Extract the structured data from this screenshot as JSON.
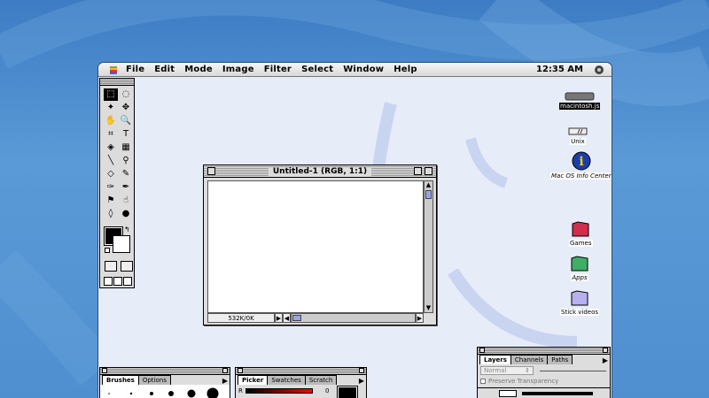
{
  "menubar": {
    "apple_icon": "apple-icon",
    "items": [
      "File",
      "Edit",
      "Mode",
      "Image",
      "Filter",
      "Select",
      "Window",
      "Help"
    ],
    "clock": "12:35 AM",
    "app_icon": "photoshop-app-icon"
  },
  "toolbox": {
    "tools": [
      {
        "name": "marquee-tool",
        "glyph": "⬚",
        "selected": true
      },
      {
        "name": "lasso-tool",
        "glyph": "◌",
        "selected": false
      },
      {
        "name": "magic-wand-tool",
        "glyph": "✦",
        "selected": false
      },
      {
        "name": "move-tool",
        "glyph": "✥",
        "selected": false
      },
      {
        "name": "hand-tool",
        "glyph": "✋",
        "selected": false
      },
      {
        "name": "zoom-tool",
        "glyph": "🔍",
        "selected": false
      },
      {
        "name": "crop-tool",
        "glyph": "⌗",
        "selected": false
      },
      {
        "name": "type-tool",
        "glyph": "T",
        "selected": false
      },
      {
        "name": "paint-bucket-tool",
        "glyph": "◈",
        "selected": false
      },
      {
        "name": "gradient-tool",
        "glyph": "▦",
        "selected": false
      },
      {
        "name": "line-tool",
        "glyph": "╲",
        "selected": false
      },
      {
        "name": "eyedropper-tool",
        "glyph": "⚲",
        "selected": false
      },
      {
        "name": "eraser-tool",
        "glyph": "◇",
        "selected": false
      },
      {
        "name": "pencil-tool",
        "glyph": "✎",
        "selected": false
      },
      {
        "name": "airbrush-tool",
        "glyph": "✑",
        "selected": false
      },
      {
        "name": "paintbrush-tool",
        "glyph": "✒",
        "selected": false
      },
      {
        "name": "rubber-stamp-tool",
        "glyph": "⚑",
        "selected": false
      },
      {
        "name": "smudge-tool",
        "glyph": "☝",
        "selected": false
      },
      {
        "name": "blur-tool",
        "glyph": "◊",
        "selected": false
      },
      {
        "name": "dodge-tool",
        "glyph": "●",
        "selected": false
      }
    ],
    "foreground_color": "#000000",
    "background_color": "#ffffff"
  },
  "document": {
    "title": "Untitled-1 (RGB, 1:1)",
    "status": "532K/0K"
  },
  "desktop_icons": [
    {
      "name": "macintosh-hd-icon",
      "label": "macintosh.js",
      "highlighted": true
    },
    {
      "name": "unix-icon",
      "label": "Unix",
      "highlighted": false
    },
    {
      "name": "info-center-icon",
      "label": "Mac OS Info Center",
      "highlighted": false
    },
    {
      "name": "games-folder-icon",
      "label": "Games",
      "highlighted": false
    },
    {
      "name": "apps-folder-icon",
      "label": "Apps",
      "highlighted": false
    },
    {
      "name": "stick-videos-folder-icon",
      "label": "Stick videos",
      "highlighted": false
    }
  ],
  "brushes_palette": {
    "tabs": [
      "Brushes",
      "Options"
    ]
  },
  "picker_palette": {
    "tabs": [
      "Picker",
      "Swatches",
      "Scratch"
    ],
    "channel_label": "R",
    "channel_value": "0"
  },
  "layers_palette": {
    "tabs": [
      "Layers",
      "Channels",
      "Paths"
    ],
    "blend_mode": "Normal",
    "preserve_label": "Preserve Transparency"
  },
  "colors": {
    "wallpaper": "#4f8fd0",
    "screen_bg": "#e7ecf9",
    "selection": "#9aa6e0"
  }
}
